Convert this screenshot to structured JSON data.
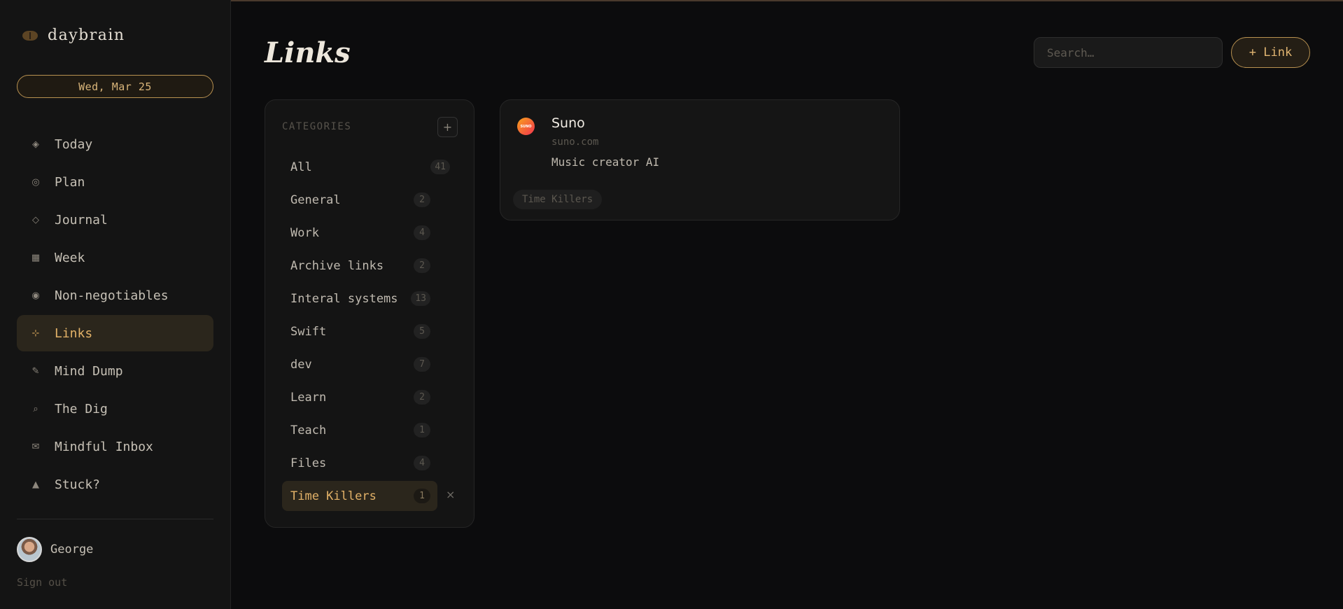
{
  "app": {
    "name": "daybrain",
    "date": "Wed, Mar 25"
  },
  "sidebar": {
    "items": [
      {
        "label": "Today",
        "icon": "◈",
        "icon_name": "diamond-dot-icon"
      },
      {
        "label": "Plan",
        "icon": "◎",
        "icon_name": "target-icon"
      },
      {
        "label": "Journal",
        "icon": "◇",
        "icon_name": "diamond-icon"
      },
      {
        "label": "Week",
        "icon": "▦",
        "icon_name": "grid-icon"
      },
      {
        "label": "Non-negotiables",
        "icon": "◉",
        "icon_name": "bullseye-icon"
      },
      {
        "label": "Links",
        "icon": "⊹",
        "icon_name": "sparkle-icon",
        "active": true
      },
      {
        "label": "Mind Dump",
        "icon": "✎",
        "icon_name": "pencil-icon"
      },
      {
        "label": "The Dig",
        "icon": "⌕",
        "icon_name": "search-icon"
      },
      {
        "label": "Mindful Inbox",
        "icon": "✉",
        "icon_name": "mail-icon"
      },
      {
        "label": "Stuck?",
        "icon": "▲",
        "icon_name": "triangle-icon"
      }
    ],
    "user": {
      "name": "George"
    },
    "signout": "Sign out"
  },
  "main": {
    "title": "Links",
    "search": {
      "placeholder": "Search…"
    },
    "add_button": "+ Link",
    "categories": {
      "header": "CATEGORIES",
      "add": "+",
      "items": [
        {
          "label": "All",
          "count": "41"
        },
        {
          "label": "General",
          "count": "2"
        },
        {
          "label": "Work",
          "count": "4"
        },
        {
          "label": "Archive links",
          "count": "2"
        },
        {
          "label": "Interal systems",
          "count": "13"
        },
        {
          "label": "Swift",
          "count": "5"
        },
        {
          "label": "dev",
          "count": "7"
        },
        {
          "label": "Learn",
          "count": "2"
        },
        {
          "label": "Teach",
          "count": "1"
        },
        {
          "label": "Files",
          "count": "4"
        },
        {
          "label": "Time Killers",
          "count": "1",
          "active": true
        }
      ],
      "remove": "×"
    },
    "links": [
      {
        "title": "Suno",
        "domain": "suno.com",
        "description": "Music creator AI",
        "tag": "Time Killers",
        "favicon_text": "SUNO"
      }
    ]
  },
  "colors": {
    "accent": "#e3b268",
    "background": "#0c0c0d",
    "sidebar": "#141414",
    "active_bg": "#2b261c"
  }
}
